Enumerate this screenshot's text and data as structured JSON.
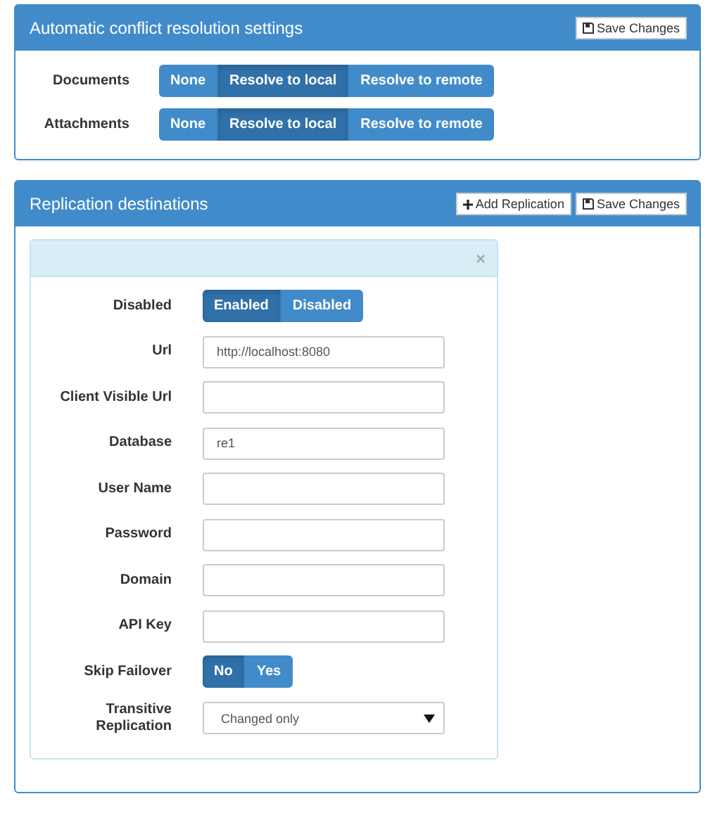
{
  "conflict_settings": {
    "title": "Automatic conflict resolution settings",
    "save_button": "Save Changes",
    "rows": [
      {
        "label": "Documents",
        "options": [
          {
            "label": "None",
            "selected": false
          },
          {
            "label": "Resolve to local",
            "selected": true
          },
          {
            "label": "Resolve to remote",
            "selected": false
          }
        ]
      },
      {
        "label": "Attachments",
        "options": [
          {
            "label": "None",
            "selected": false
          },
          {
            "label": "Resolve to local",
            "selected": true
          },
          {
            "label": "Resolve to remote",
            "selected": false
          }
        ]
      }
    ]
  },
  "replication": {
    "title": "Replication destinations",
    "add_button": "Add Replication",
    "save_button": "Save Changes",
    "destination": {
      "close": "×",
      "fields": [
        {
          "kind": "toggle",
          "label": "Disabled",
          "options": [
            {
              "label": "Enabled",
              "selected": true
            },
            {
              "label": "Disabled",
              "selected": false
            }
          ]
        },
        {
          "kind": "text",
          "label": "Url",
          "value": "http://localhost:8080"
        },
        {
          "kind": "text",
          "label": "Client Visible Url"
        },
        {
          "kind": "text",
          "label": "Database",
          "value": "re1"
        },
        {
          "kind": "text",
          "label": "User Name"
        },
        {
          "kind": "text",
          "label": "Password"
        },
        {
          "kind": "text",
          "label": "Domain"
        },
        {
          "kind": "text",
          "label": "API Key"
        },
        {
          "kind": "toggle",
          "label": "Skip Failover",
          "options": [
            {
              "label": "No",
              "selected": true
            },
            {
              "label": "Yes",
              "selected": false
            }
          ]
        },
        {
          "kind": "select",
          "label": "Transitive Replication",
          "value": "Changed only"
        }
      ]
    }
  }
}
